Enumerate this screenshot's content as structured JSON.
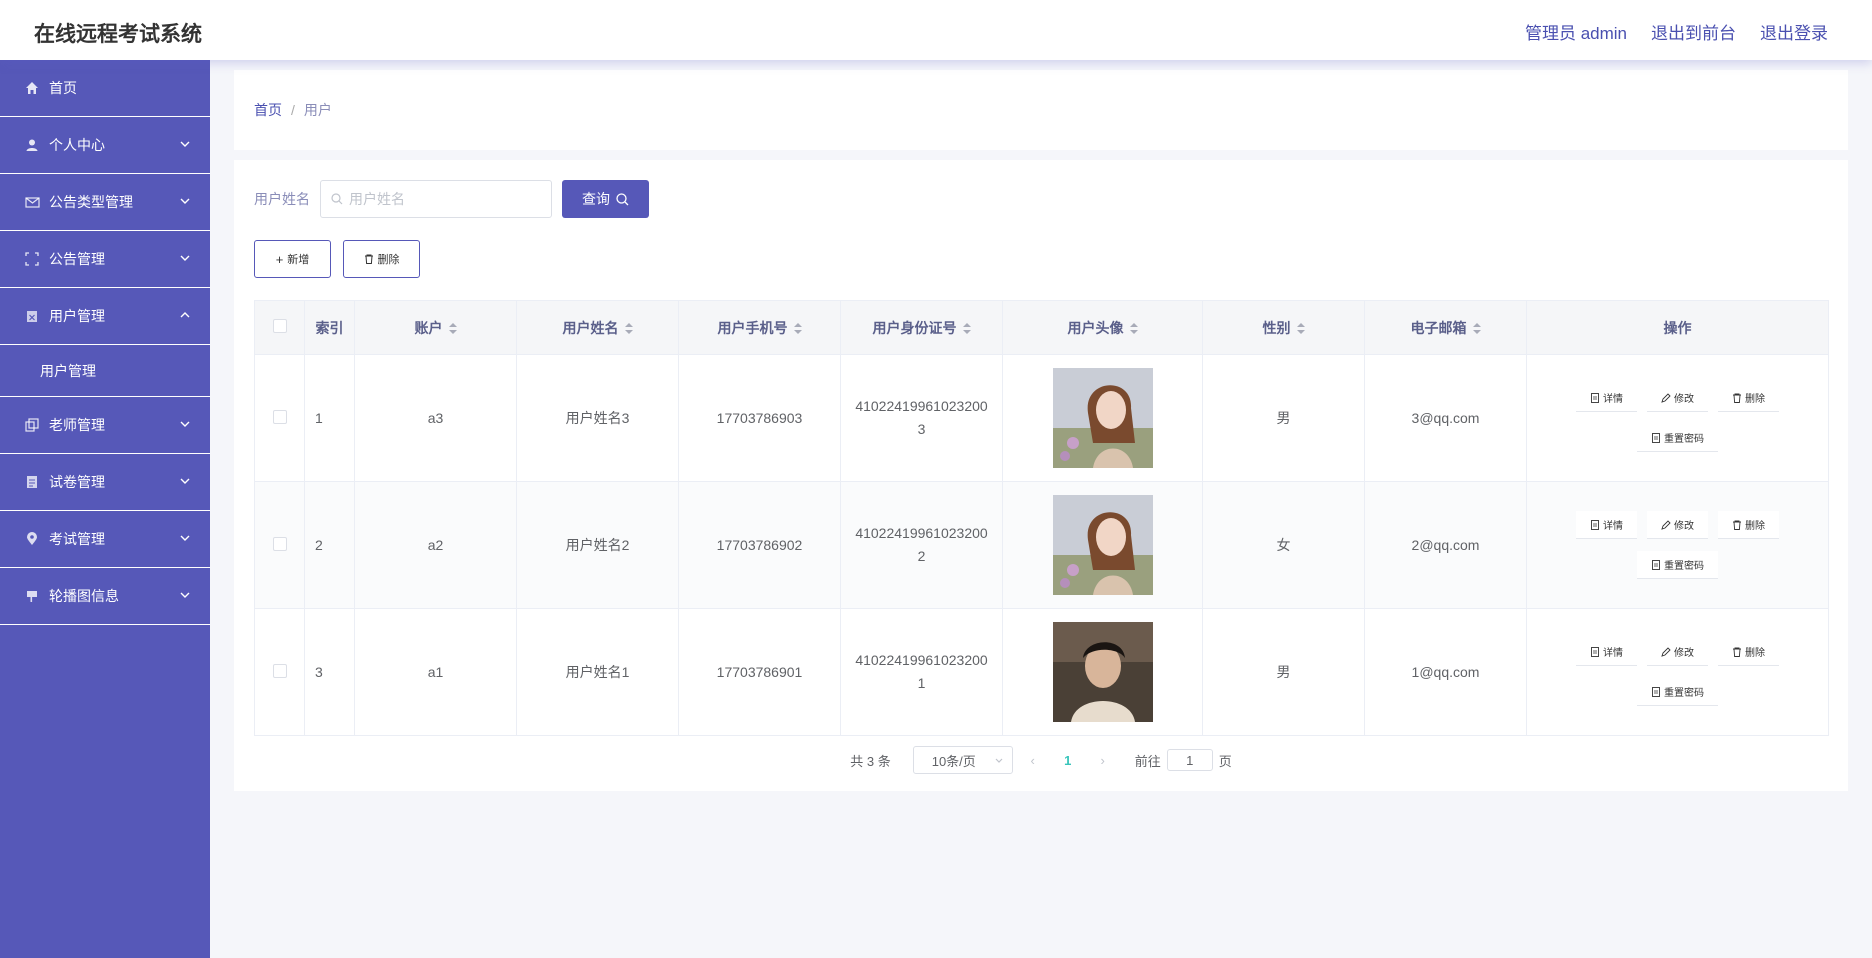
{
  "header": {
    "title": "在线远程考试系统",
    "links": [
      "管理员 admin",
      "退出到前台",
      "退出登录"
    ]
  },
  "sidebar": {
    "items": [
      {
        "label": "首页",
        "icon": "home-icon"
      },
      {
        "label": "个人中心",
        "icon": "user-icon"
      },
      {
        "label": "公告类型管理",
        "icon": "mail-icon"
      },
      {
        "label": "公告管理",
        "icon": "fullscreen-icon"
      },
      {
        "label": "用户管理",
        "icon": "clipboard-icon",
        "expanded": true
      },
      {
        "label": "老师管理",
        "icon": "copy-icon"
      },
      {
        "label": "试卷管理",
        "icon": "document-icon"
      },
      {
        "label": "考试管理",
        "icon": "location-icon"
      },
      {
        "label": "轮播图信息",
        "icon": "flag-icon"
      }
    ],
    "sub_item": "用户管理"
  },
  "breadcrumb": {
    "home": "首页",
    "separator": "/",
    "current": "用户"
  },
  "search": {
    "label": "用户姓名",
    "placeholder": "用户姓名",
    "button": "查询"
  },
  "actions": {
    "add": "新增",
    "delete": "删除"
  },
  "table": {
    "headers": [
      "索引",
      "账户",
      "用户姓名",
      "用户手机号",
      "用户身份证号",
      "用户头像",
      "性别",
      "电子邮箱",
      "操作"
    ],
    "rows": [
      {
        "index": "1",
        "account": "a3",
        "name": "用户姓名3",
        "phone": "17703786903",
        "id_line1": "41022419961023200",
        "id_line2": "3",
        "gender": "男",
        "email": "3@qq.com",
        "avatar": "woman"
      },
      {
        "index": "2",
        "account": "a2",
        "name": "用户姓名2",
        "phone": "17703786902",
        "id_line1": "41022419961023200",
        "id_line2": "2",
        "gender": "女",
        "email": "2@qq.com",
        "avatar": "woman"
      },
      {
        "index": "3",
        "account": "a1",
        "name": "用户姓名1",
        "phone": "17703786901",
        "id_line1": "41022419961023200",
        "id_line2": "1",
        "gender": "男",
        "email": "1@qq.com",
        "avatar": "man"
      }
    ],
    "ops": {
      "detail": "详情",
      "edit": "修改",
      "delete": "删除",
      "reset": "重置密码"
    }
  },
  "pagination": {
    "total": "共 3 条",
    "page_size": "10条/页",
    "current_page": "1",
    "goto_label": "前往",
    "goto_value": "1",
    "page_suffix": "页"
  },
  "colors": {
    "primary": "#5658b8",
    "link": "#4a50b0",
    "active_page": "#39c5bb"
  }
}
